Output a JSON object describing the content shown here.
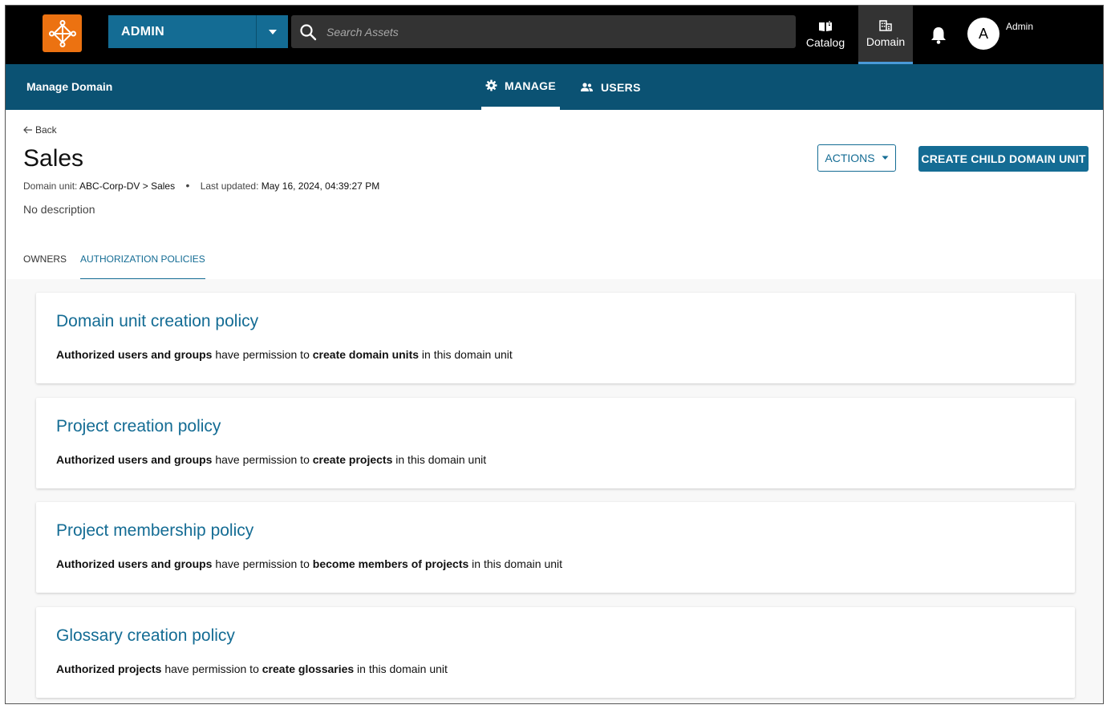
{
  "header": {
    "domain_select": "ADMIN",
    "search_placeholder": "Search Assets",
    "nav": [
      {
        "label": "Catalog",
        "icon": "book-icon"
      },
      {
        "label": "Domain",
        "icon": "building-icon"
      }
    ],
    "avatar_initial": "A",
    "username": "Admin"
  },
  "subnav": {
    "title": "Manage Domain",
    "tabs": [
      "MANAGE",
      "USERS"
    ]
  },
  "page": {
    "back_label": "Back",
    "title": "Sales",
    "domain_unit_label": "Domain unit:",
    "domain_unit_value": "ABC-Corp-DV > Sales",
    "last_updated_label": "Last updated:",
    "last_updated_value": "May 16, 2024, 04:39:27 PM",
    "description": "No description",
    "actions_label": "ACTIONS",
    "create_label": "CREATE CHILD DOMAIN UNIT",
    "tabs": [
      "OWNERS",
      "AUTHORIZATION POLICIES"
    ]
  },
  "policies": [
    {
      "title": "Domain unit creation policy",
      "subject": "Authorized users and groups",
      "mid": " have permission to ",
      "action": "create domain units",
      "tail": " in this domain unit"
    },
    {
      "title": "Project creation policy",
      "subject": "Authorized users and groups",
      "mid": " have permission to ",
      "action": "create projects",
      "tail": " in this domain unit"
    },
    {
      "title": "Project membership policy",
      "subject": "Authorized users and groups",
      "mid": " have permission to ",
      "action": "become members of projects",
      "tail": " in this domain unit"
    },
    {
      "title": "Glossary creation policy",
      "subject": "Authorized projects",
      "mid": " have permission to ",
      "action": "create glossaries",
      "tail": " in this domain unit"
    }
  ],
  "colors": {
    "accent": "#146c94",
    "subnav_bg": "#0b5273",
    "logo": "#ec7211"
  }
}
